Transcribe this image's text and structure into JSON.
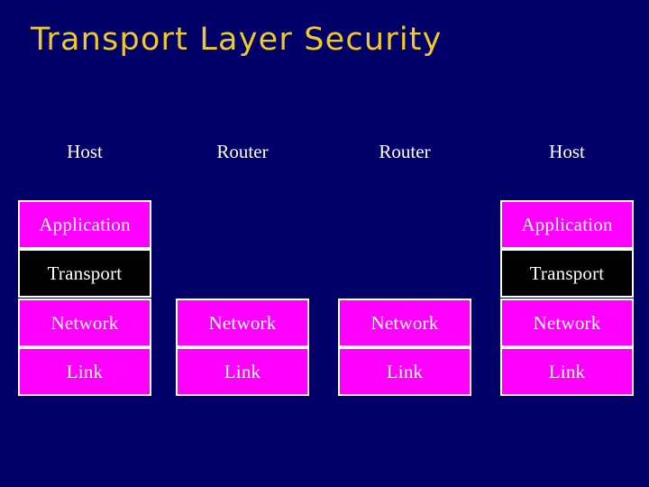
{
  "slide": {
    "title": "Transport Layer Security",
    "background_color": "#000068",
    "title_color": "#EFC82C"
  },
  "diagram": {
    "box_colors": {
      "default": "#FF00FF",
      "highlight": "#000000",
      "border": "#FFFFFF",
      "text": "#FFFFFF"
    },
    "columns": [
      {
        "header": "Host",
        "layers": [
          {
            "label": "Application",
            "style": "magenta"
          },
          {
            "label": "Transport",
            "style": "black"
          },
          {
            "label": "Network",
            "style": "magenta"
          },
          {
            "label": "Link",
            "style": "magenta"
          }
        ]
      },
      {
        "header": "Router",
        "layers": [
          {
            "label": "Network",
            "style": "magenta"
          },
          {
            "label": "Link",
            "style": "magenta"
          }
        ]
      },
      {
        "header": "Router",
        "layers": [
          {
            "label": "Network",
            "style": "magenta"
          },
          {
            "label": "Link",
            "style": "magenta"
          }
        ]
      },
      {
        "header": "Host",
        "layers": [
          {
            "label": "Application",
            "style": "magenta"
          },
          {
            "label": "Transport",
            "style": "black"
          },
          {
            "label": "Network",
            "style": "magenta"
          },
          {
            "label": "Link",
            "style": "magenta"
          }
        ]
      }
    ]
  }
}
